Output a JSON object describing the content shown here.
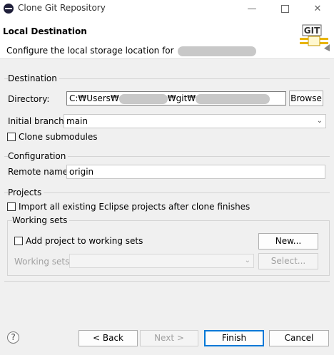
{
  "window": {
    "title": "Clone Git Repository"
  },
  "header": {
    "title": "Local Destination",
    "description": "Configure the local storage location for",
    "logo_text": "GIT"
  },
  "destination": {
    "group_label": "Destination",
    "directory_label": "Directory:",
    "directory_parts": [
      "C:₩Users₩",
      "₩git₩"
    ],
    "browse_label": "Browse",
    "initial_branch_label": "Initial branch:",
    "initial_branch_value": "main",
    "clone_submodules_label": "Clone submodules",
    "clone_submodules_checked": false
  },
  "configuration": {
    "group_label": "Configuration",
    "remote_name_label": "Remote name:",
    "remote_name_value": "origin"
  },
  "projects": {
    "group_label": "Projects",
    "import_label": "Import all existing Eclipse projects after clone finishes",
    "import_checked": false,
    "working_sets": {
      "group_label": "Working sets",
      "add_label": "Add project to working sets",
      "add_checked": false,
      "new_label": "New...",
      "sets_label": "Working sets:",
      "select_label": "Select..."
    }
  },
  "footer": {
    "help_symbol": "?",
    "back_label": "< Back",
    "next_label": "Next >",
    "finish_label": "Finish",
    "cancel_label": "Cancel"
  },
  "icons": {
    "window_minimize": "minimize-icon",
    "window_maximize": "maximize-icon",
    "window_close": "close-icon",
    "combo_arrow": "chevron-down-icon",
    "help": "help-icon"
  },
  "colors": {
    "dialog_background": "#f0f0f0",
    "default_button_border": "#0078d7",
    "git_logo_gold": "#e8b400"
  }
}
